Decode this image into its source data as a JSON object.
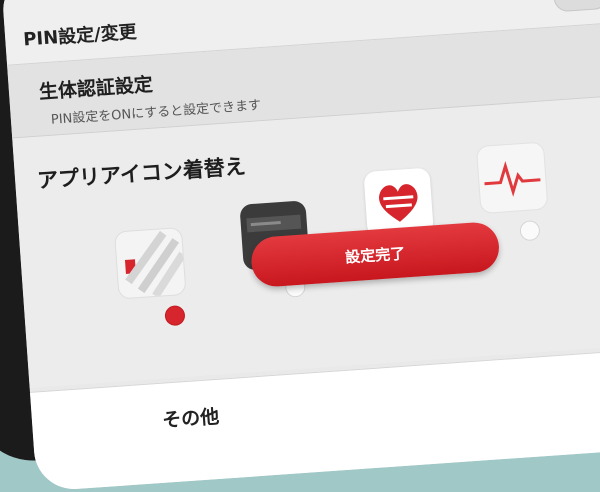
{
  "settings": {
    "pin_label": "PIN設定/変更",
    "biometric_title": "生体認証設定",
    "biometric_note": "PIN設定をONにすると設定できます",
    "icon_section_title": "アプリアイコン着替え",
    "icons": [
      {
        "icon": "stripe-app-icon",
        "selected": true
      },
      {
        "icon": "dark-app-icon",
        "selected": false
      },
      {
        "icon": "heart-app-icon",
        "selected": false
      },
      {
        "icon": "pulse-app-icon",
        "selected": false
      }
    ],
    "done_button": "設定完了",
    "other_label": "その他"
  },
  "colors": {
    "accent": "#d6252c",
    "background": "#e9e9e9"
  }
}
